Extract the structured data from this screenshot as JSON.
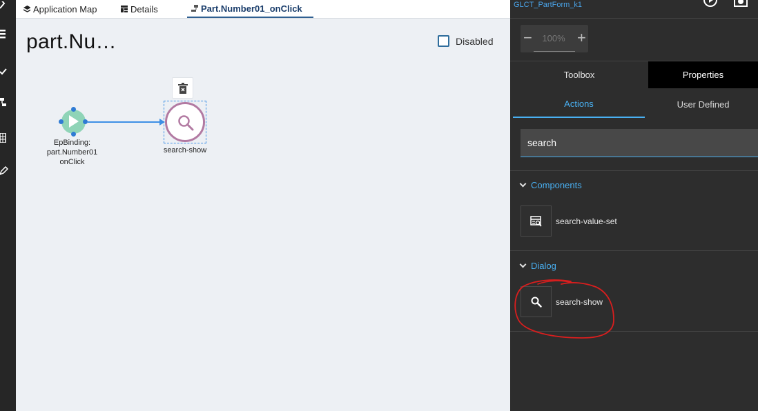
{
  "tabs": [
    {
      "label": "Application Map",
      "icon": "layers-icon"
    },
    {
      "label": "Details",
      "icon": "table-icon"
    },
    {
      "label": "Part.Number01_onClick",
      "icon": "flow-icon",
      "active": true
    }
  ],
  "canvas": {
    "title": "part.Nu…",
    "disabled_label": "Disabled",
    "disabled_checked": false,
    "start_node": {
      "line1": "EpBinding:",
      "line2": "part.Number01",
      "line3": "onClick"
    },
    "action_node": {
      "label": "search-show"
    }
  },
  "panel": {
    "title": "GLCT_PartForm_k1",
    "zoom": {
      "minus": "−",
      "value": "100%",
      "plus": "+"
    },
    "tabs": {
      "toolbox": "Toolbox",
      "properties": "Properties"
    },
    "subtabs": {
      "actions": "Actions",
      "user_defined": "User Defined"
    },
    "search_value": "search",
    "sections": [
      {
        "name": "Components",
        "items": [
          {
            "label": "search-value-set",
            "icon": "search-value-set-icon"
          }
        ]
      },
      {
        "name": "Dialog",
        "items": [
          {
            "label": "search-show",
            "icon": "search-icon"
          }
        ]
      }
    ]
  },
  "colors": {
    "accent": "#49b0f2",
    "annotation": "#d91e1e",
    "start_node": "#8fd4b7",
    "action_node_border": "#b27aa2"
  }
}
